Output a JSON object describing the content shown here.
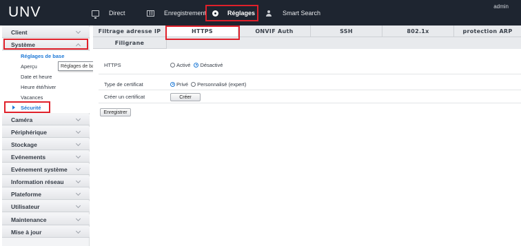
{
  "app": {
    "logo": "UNV",
    "user": "admin"
  },
  "nav": {
    "direct": "Direct",
    "enregistrement": "Enregistrement",
    "reglages": "Réglages",
    "smart_search": "Smart Search"
  },
  "sidebar": {
    "client": "Client",
    "systeme": "Système",
    "sub_items": {
      "reglages_de_base": "Réglages de base",
      "apercu": "Aperçu",
      "date_et_heure": "Date et heure",
      "heure_ete_hiver": "Heure été/hiver",
      "vacances": "Vacances",
      "securite": "Sécurité"
    },
    "tooltip": "Réglages de base",
    "camera": "Caméra",
    "peripherique": "Périphérique",
    "stockage": "Stockage",
    "evenements": "Evénements",
    "evenement_systeme": "Evénement système",
    "information_reseau": "Information réseau",
    "plateforme": "Plateforme",
    "utilisateur": "Utilisateur",
    "maintenance": "Maintenance",
    "mise_a_jour": "Mise à jour"
  },
  "tabs": {
    "filtrage": "Filtrage adresse IP",
    "https": "HTTPS",
    "onvif": "ONVIF Auth",
    "ssh": "SSH",
    "x8021": "802.1x",
    "protection_arp": "protection ARP",
    "filigrane": "Filigrane"
  },
  "form": {
    "https_label": "HTTPS",
    "active": "Activé",
    "desactive": "Désactivé",
    "https_selected": "Désactivé",
    "type_cert_label": "Type de certificat",
    "prive": "Privé",
    "personnalise": "Personnalisé (expert)",
    "cert_selected": "Privé",
    "creer_cert_label": "Créer un certificat",
    "creer_button": "Créer",
    "enregistrer_button": "Enregistrer"
  },
  "colors": {
    "topbar": "#1e2530",
    "accent_blue": "#1c78d6",
    "highlight_red": "#e0202a"
  },
  "icons": [
    "monitor-icon",
    "film-icon",
    "gear-icon",
    "person-search-icon",
    "chevron-down-icon",
    "chevron-up-icon",
    "triangle-right-icon"
  ]
}
